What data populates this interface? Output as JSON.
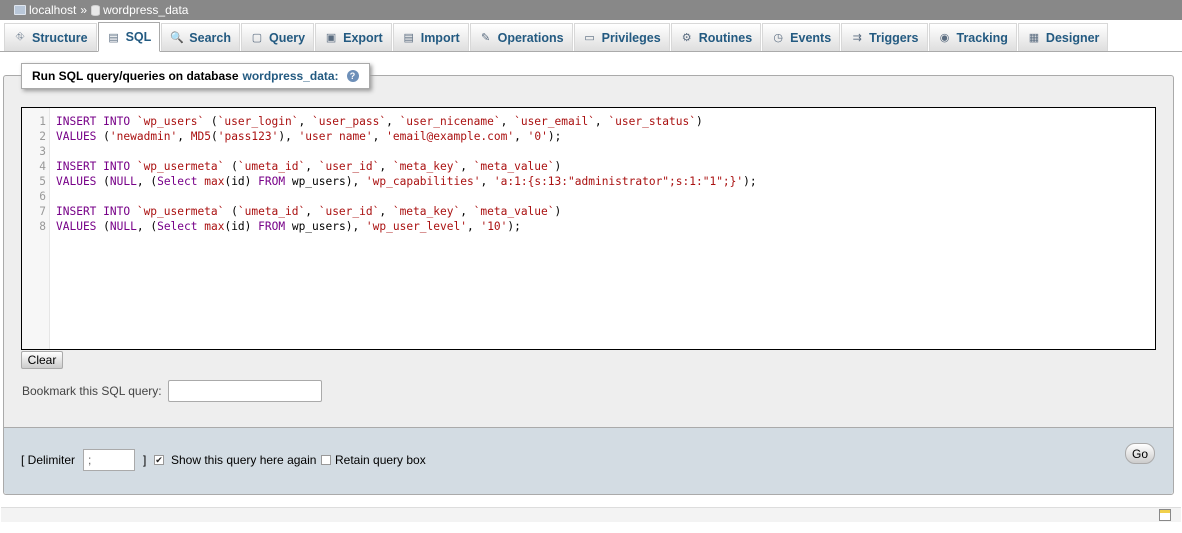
{
  "breadcrumb": {
    "server": "localhost",
    "separator": "»",
    "database": "wordpress_data"
  },
  "tabs": [
    {
      "label": "Structure",
      "icon": "structure-icon",
      "glyph": "⛗",
      "active": false
    },
    {
      "label": "SQL",
      "icon": "sql-icon",
      "glyph": "▤",
      "active": true
    },
    {
      "label": "Search",
      "icon": "search-icon",
      "glyph": "🔍",
      "active": false
    },
    {
      "label": "Query",
      "icon": "query-icon",
      "glyph": "▢",
      "active": false
    },
    {
      "label": "Export",
      "icon": "export-icon",
      "glyph": "▣",
      "active": false
    },
    {
      "label": "Import",
      "icon": "import-icon",
      "glyph": "▤",
      "active": false
    },
    {
      "label": "Operations",
      "icon": "wrench-icon",
      "glyph": "✎",
      "active": false
    },
    {
      "label": "Privileges",
      "icon": "privileges-icon",
      "glyph": "▭",
      "active": false
    },
    {
      "label": "Routines",
      "icon": "routines-icon",
      "glyph": "⚙",
      "active": false
    },
    {
      "label": "Events",
      "icon": "clock-icon",
      "glyph": "◷",
      "active": false
    },
    {
      "label": "Triggers",
      "icon": "triggers-icon",
      "glyph": "⇉",
      "active": false
    },
    {
      "label": "Tracking",
      "icon": "eye-icon",
      "glyph": "◉",
      "active": false
    },
    {
      "label": "Designer",
      "icon": "designer-icon",
      "glyph": "▦",
      "active": false
    }
  ],
  "query_box": {
    "legend_prefix": "Run SQL query/queries on database",
    "database": "wordpress_data:",
    "help": "?"
  },
  "editor": {
    "line_numbers": [
      "1",
      "2",
      "3",
      "4",
      "5",
      "6",
      "7",
      "8"
    ],
    "lines": [
      [
        [
          "kw",
          "INSERT INTO "
        ],
        [
          "str",
          "`wp_users`"
        ],
        [
          "id",
          " ("
        ],
        [
          "str",
          "`user_login`"
        ],
        [
          "id",
          ", "
        ],
        [
          "str",
          "`user_pass`"
        ],
        [
          "id",
          ", "
        ],
        [
          "str",
          "`user_nicename`"
        ],
        [
          "id",
          ", "
        ],
        [
          "str",
          "`user_email`"
        ],
        [
          "id",
          ", "
        ],
        [
          "str",
          "`user_status`"
        ],
        [
          "id",
          ")"
        ]
      ],
      [
        [
          "kw",
          "VALUES "
        ],
        [
          "id",
          "("
        ],
        [
          "str",
          "'newadmin'"
        ],
        [
          "id",
          ", "
        ],
        [
          "fn",
          "MD5"
        ],
        [
          "id",
          "("
        ],
        [
          "str",
          "'pass123'"
        ],
        [
          "id",
          "), "
        ],
        [
          "str",
          "'user name'"
        ],
        [
          "id",
          ", "
        ],
        [
          "str",
          "'email@example.com'"
        ],
        [
          "id",
          ", "
        ],
        [
          "str",
          "'0'"
        ],
        [
          "id",
          ");"
        ]
      ],
      [],
      [
        [
          "kw",
          "INSERT INTO "
        ],
        [
          "str",
          "`wp_usermeta`"
        ],
        [
          "id",
          " ("
        ],
        [
          "str",
          "`umeta_id`"
        ],
        [
          "id",
          ", "
        ],
        [
          "str",
          "`user_id`"
        ],
        [
          "id",
          ", "
        ],
        [
          "str",
          "`meta_key`"
        ],
        [
          "id",
          ", "
        ],
        [
          "str",
          "`meta_value`"
        ],
        [
          "id",
          ")"
        ]
      ],
      [
        [
          "kw",
          "VALUES "
        ],
        [
          "id",
          "("
        ],
        [
          "kw",
          "NULL"
        ],
        [
          "id",
          ", ("
        ],
        [
          "kw",
          "Select "
        ],
        [
          "fn",
          "max"
        ],
        [
          "id",
          "(id) "
        ],
        [
          "kw",
          "FROM "
        ],
        [
          "id",
          "wp_users), "
        ],
        [
          "str",
          "'wp_capabilities'"
        ],
        [
          "id",
          ", "
        ],
        [
          "str",
          "'a:1:{s:13:\"administrator\";s:1:\"1\";}'"
        ],
        [
          "id",
          ");"
        ]
      ],
      [],
      [
        [
          "kw",
          "INSERT INTO "
        ],
        [
          "str",
          "`wp_usermeta`"
        ],
        [
          "id",
          " ("
        ],
        [
          "str",
          "`umeta_id`"
        ],
        [
          "id",
          ", "
        ],
        [
          "str",
          "`user_id`"
        ],
        [
          "id",
          ", "
        ],
        [
          "str",
          "`meta_key`"
        ],
        [
          "id",
          ", "
        ],
        [
          "str",
          "`meta_value`"
        ],
        [
          "id",
          ")"
        ]
      ],
      [
        [
          "kw",
          "VALUES "
        ],
        [
          "id",
          "("
        ],
        [
          "kw",
          "NULL"
        ],
        [
          "id",
          ", ("
        ],
        [
          "kw",
          "Select "
        ],
        [
          "fn",
          "max"
        ],
        [
          "id",
          "(id) "
        ],
        [
          "kw",
          "FROM "
        ],
        [
          "id",
          "wp_users), "
        ],
        [
          "str",
          "'wp_user_level'"
        ],
        [
          "id",
          ", "
        ],
        [
          "str",
          "'10'"
        ],
        [
          "id",
          ");"
        ]
      ]
    ]
  },
  "buttons": {
    "clear": "Clear",
    "go": "Go"
  },
  "bookmark": {
    "label": "Bookmark this SQL query:",
    "value": ""
  },
  "options": {
    "delimiter_label": "[ Delimiter",
    "delimiter_value": ";",
    "delimiter_close": "]",
    "show_query_again": {
      "label": "Show this query here again",
      "checked": true
    },
    "retain_query_box": {
      "label": "Retain query box",
      "checked": false
    }
  }
}
